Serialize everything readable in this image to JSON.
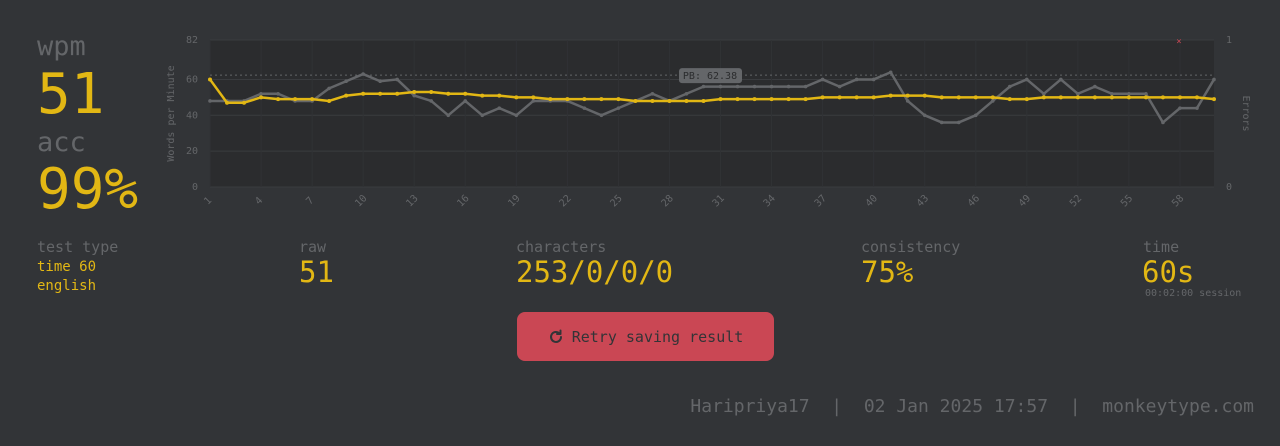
{
  "stats": {
    "wpm_label": "wpm",
    "wpm_value": "51",
    "acc_label": "acc",
    "acc_value": "99%"
  },
  "details": {
    "test_type_label": "test type",
    "test_type_mode": "time 60",
    "test_type_language": "english",
    "raw_label": "raw",
    "raw_value": "51",
    "characters_label": "characters",
    "characters_value": "253/0/0/0",
    "consistency_label": "consistency",
    "consistency_value": "75%",
    "time_label": "time",
    "time_value": "60s",
    "session_time": "00:02:00 session"
  },
  "retry": {
    "label": "Retry saving result",
    "icon": "refresh-icon"
  },
  "footer": {
    "username": "Haripriya17",
    "datetime": "02 Jan 2025 17:57",
    "site": "monkeytype.com",
    "separator": "|"
  },
  "colors": {
    "background": "#323437",
    "text_sub": "#646669",
    "main": "#e2b714",
    "error": "#ca4754",
    "raw_line": "#646669"
  },
  "chart_data": {
    "type": "line",
    "x": [
      1,
      2,
      3,
      4,
      5,
      6,
      7,
      8,
      9,
      10,
      11,
      12,
      13,
      14,
      15,
      16,
      17,
      18,
      19,
      20,
      21,
      22,
      23,
      24,
      25,
      26,
      27,
      28,
      29,
      30,
      31,
      32,
      33,
      34,
      35,
      36,
      37,
      38,
      39,
      40,
      41,
      42,
      43,
      44,
      45,
      46,
      47,
      48,
      49,
      50,
      51,
      52,
      53,
      54,
      55,
      56,
      57,
      58,
      59,
      60
    ],
    "x_tick_labels": [
      "1",
      "4",
      "7",
      "10",
      "13",
      "16",
      "19",
      "22",
      "25",
      "28",
      "31",
      "34",
      "37",
      "40",
      "43",
      "46",
      "49",
      "52",
      "55",
      "58"
    ],
    "ylabel": "Words per Minute",
    "y2label": "Errors",
    "ylim": [
      0,
      82
    ],
    "y_ticks": [
      0,
      20,
      40,
      60,
      82
    ],
    "y2lim": [
      0,
      1
    ],
    "y2_ticks": [
      0,
      1
    ],
    "series": [
      {
        "key": "wpm",
        "color": "#e2b714",
        "values": [
          60,
          47,
          47,
          50,
          49,
          49,
          49,
          48,
          51,
          52,
          52,
          52,
          53,
          53,
          52,
          52,
          51,
          51,
          50,
          50,
          49,
          49,
          49,
          49,
          49,
          48,
          48,
          48,
          48,
          48,
          49,
          49,
          49,
          49,
          49,
          49,
          50,
          50,
          50,
          50,
          51,
          51,
          51,
          50,
          50,
          50,
          50,
          49,
          49,
          50,
          50,
          50,
          50,
          50,
          50,
          50,
          50,
          50,
          50,
          49
        ]
      },
      {
        "key": "raw",
        "color": "#646669",
        "values": [
          48,
          48,
          48,
          52,
          52,
          48,
          48,
          55,
          59,
          63,
          59,
          60,
          51,
          48,
          40,
          48,
          40,
          44,
          40,
          48,
          48,
          48,
          44,
          40,
          44,
          48,
          52,
          48,
          52,
          56,
          56,
          56,
          56,
          56,
          56,
          56,
          60,
          56,
          60,
          60,
          64,
          48,
          40,
          36,
          36,
          40,
          48,
          56,
          60,
          52,
          60,
          52,
          56,
          52,
          52,
          52,
          36,
          44,
          44,
          60
        ]
      }
    ],
    "annotation": "PB: 62.38",
    "pb_value": 62.38,
    "grid": true
  }
}
